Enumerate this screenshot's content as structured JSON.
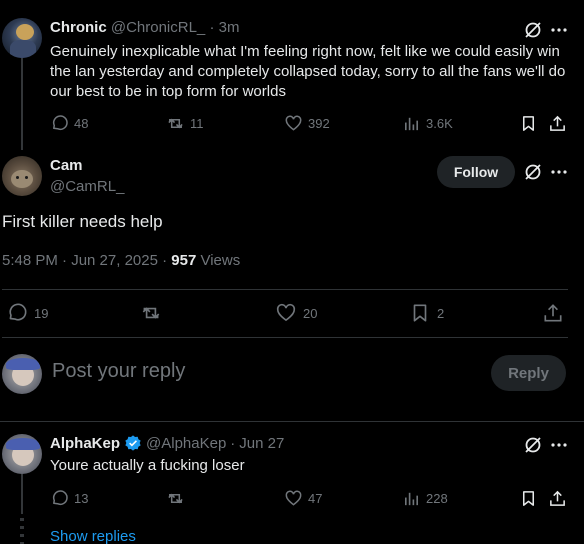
{
  "tweet1": {
    "name": "Chronic",
    "handle": "@ChronicRL_",
    "dot": "·",
    "time": "3m",
    "text": "Genuinely inexplicable what I'm feeling right now, felt like we could easily win the lan yesterday and completely collapsed today, sorry to all the fans we'll do our best to be in top form for worlds",
    "replies": "48",
    "reposts": "11",
    "likes": "392",
    "views": "3.6K"
  },
  "main": {
    "name": "Cam",
    "handle": "@CamRL_",
    "follow_label": "Follow",
    "text": "First killer needs help",
    "timestamp": "5:48 PM · Jun 27, 2025 · ",
    "views_count": "957",
    "views_label": " Views",
    "replies": "19",
    "likes": "20",
    "bookmarks": "2"
  },
  "reply_box": {
    "placeholder": "Post your reply",
    "button": "Reply"
  },
  "tweet2": {
    "name": "AlphaKep",
    "handle": "@AlphaKep",
    "dot": "·",
    "time": "Jun 27",
    "text": "Youre actually a fucking loser",
    "replies": "13",
    "likes": "47",
    "views": "228",
    "show_replies": "Show replies"
  },
  "colors": {
    "background": "#000000",
    "text": "#e7e9ea",
    "muted": "#71767b",
    "link": "#1d9bf0",
    "verified": "#1d9bf0",
    "follow_bg": "#1f2326"
  }
}
